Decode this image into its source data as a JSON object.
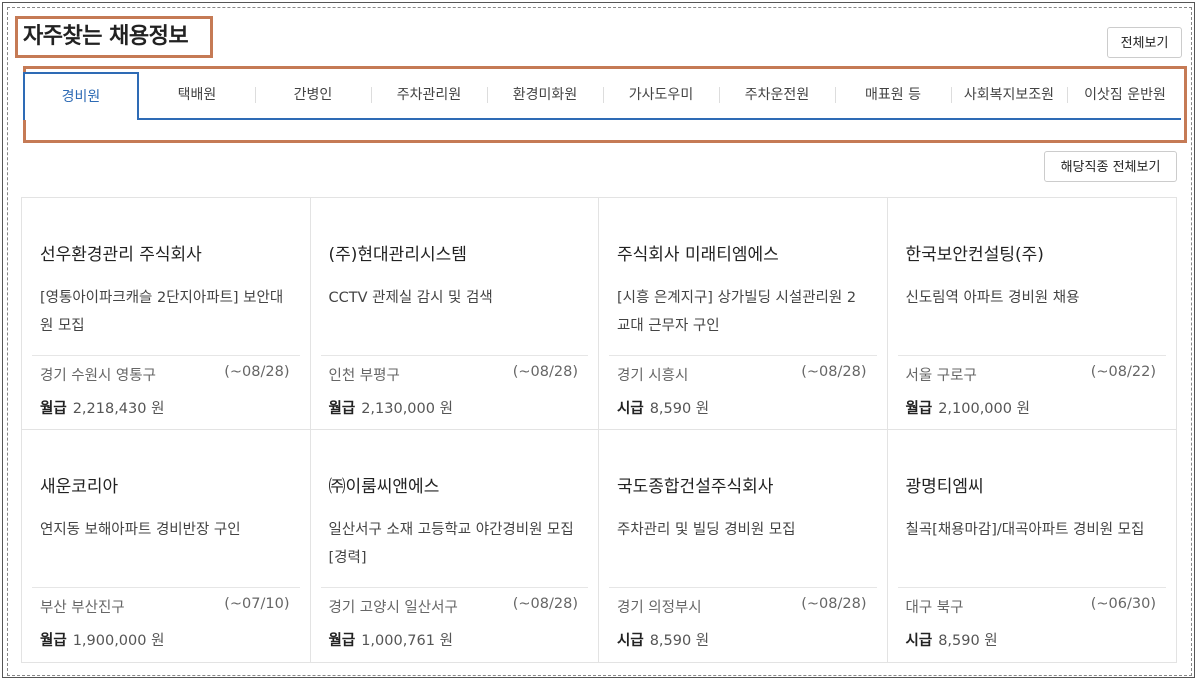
{
  "section_title": "자주찾는 채용정보",
  "view_all_label": "전체보기",
  "category_view_all_label": "해당직종 전체보기",
  "tabs": [
    {
      "label": "경비원",
      "active": true
    },
    {
      "label": "택배원"
    },
    {
      "label": "간병인"
    },
    {
      "label": "주차관리원"
    },
    {
      "label": "환경미화원"
    },
    {
      "label": "가사도우미"
    },
    {
      "label": "주차운전원"
    },
    {
      "label": "매표원 등"
    },
    {
      "label": "사회복지보조원"
    },
    {
      "label": "이삿짐 운반원"
    }
  ],
  "jobs": [
    {
      "company": "선우환경관리 주식회사",
      "title": "[영통아이파크캐슬 2단지아파트] 보안대원 모집",
      "location": "경기 수원시 영통구",
      "deadline": "(~08/28)",
      "pay_type": "월급",
      "pay": "2,218,430 원"
    },
    {
      "company": "(주)현대관리시스템",
      "title": "CCTV 관제실 감시 및 검색",
      "location": "인천 부평구",
      "deadline": "(~08/28)",
      "pay_type": "월급",
      "pay": "2,130,000 원"
    },
    {
      "company": "주식회사 미래티엠에스",
      "title": "[시흥 은계지구] 상가빌딩 시설관리원 2교대 근무자 구인",
      "location": "경기 시흥시",
      "deadline": "(~08/28)",
      "pay_type": "시급",
      "pay": "8,590 원"
    },
    {
      "company": "한국보안컨설팅(주)",
      "title": "신도림역 아파트 경비원 채용",
      "location": "서울 구로구",
      "deadline": "(~08/22)",
      "pay_type": "월급",
      "pay": "2,100,000 원"
    },
    {
      "company": "새운코리아",
      "title": "연지동 보해아파트 경비반장 구인",
      "location": "부산 부산진구",
      "deadline": "(~07/10)",
      "pay_type": "월급",
      "pay": "1,900,000 원"
    },
    {
      "company": "㈜이룸씨앤에스",
      "title": "일산서구 소재 고등학교 야간경비원 모집[경력]",
      "location": "경기 고양시 일산서구",
      "deadline": "(~08/28)",
      "pay_type": "월급",
      "pay": "1,000,761 원"
    },
    {
      "company": "국도종합건설주식회사",
      "title": "주차관리 및 빌딩 경비원 모집",
      "location": "경기 의정부시",
      "deadline": "(~08/28)",
      "pay_type": "시급",
      "pay": "8,590 원"
    },
    {
      "company": "광명티엠씨",
      "title": "칠곡[채용마감]/대곡아파트 경비원 모집",
      "location": "대구 북구",
      "deadline": "(~06/30)",
      "pay_type": "시급",
      "pay": "8,590 원"
    }
  ]
}
